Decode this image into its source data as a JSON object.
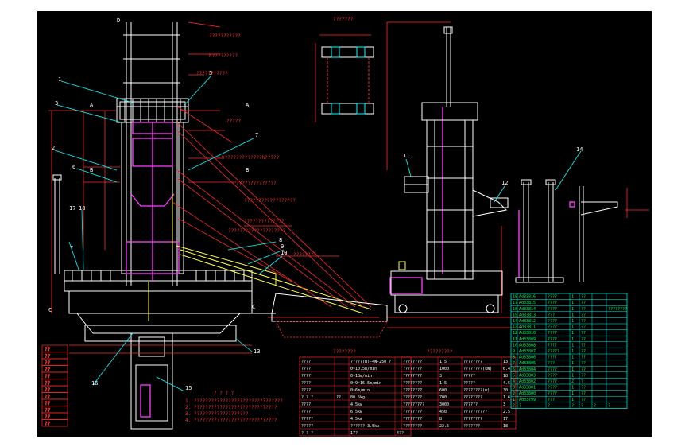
{
  "colors": {
    "background": "#000000",
    "structure": "#ffffff",
    "dimension": "#ff2a2a",
    "leader": "#00ffff",
    "hydraulic": "#ff40ff",
    "tube": "#ffff40",
    "table_grid": "#ff2a2a",
    "parts_grid": "#00ffee"
  },
  "top_label": "???????",
  "top_right_label": "?????? ?",
  "callouts_left": [
    "1",
    "2",
    "3",
    "4",
    "5",
    "6",
    "7",
    "8",
    "9",
    "10",
    "13",
    "15",
    "16",
    "17",
    "18",
    "A",
    "A",
    "B",
    "B",
    "C",
    "C",
    "D"
  ],
  "callouts_right": [
    "11",
    "12",
    "14"
  ],
  "leader_texts": [
    "???????????",
    "h?????????",
    "???????????",
    "?????",
    "h?????????????h?????",
    "??????????????",
    "??????????????????",
    "??????????????",
    "????????????????????",
    "????????"
  ],
  "notes": {
    "title": "? ? ? ?",
    "lines": [
      "1. ???????????????????????????????",
      "2. ?????????????????????????????",
      "3. ???????????????????",
      "4. ?????????????????????????????"
    ]
  },
  "spec_table_left": {
    "title": "????????",
    "rows": [
      [
        "????",
        "",
        "?????(W)-4W-250 ?",
        ""
      ],
      [
        "????",
        "",
        "0~10.5m/min",
        ""
      ],
      [
        "????",
        "",
        "0~18m/min",
        ""
      ],
      [
        "????",
        "",
        "0~9~16.5m/min",
        ""
      ],
      [
        "????",
        "",
        "0~6m/min",
        ""
      ],
      [
        "? ? ?",
        "??",
        "80.5kg",
        ""
      ],
      [
        "????",
        "",
        "4.5kw",
        ""
      ],
      [
        "????",
        "",
        "6.5kw",
        ""
      ],
      [
        "?????",
        "",
        "4.5kw",
        ""
      ],
      [
        "?????",
        "",
        "?????? 3.5kw",
        ""
      ],
      [
        "? ? ?",
        "",
        "17?",
        "4??"
      ]
    ]
  },
  "spec_table_right": {
    "title": "?????????",
    "rows": [
      [
        "????????",
        "1.5",
        "????????",
        "13"
      ],
      [
        "????????",
        "1000",
        "????????(kW)",
        "6.4"
      ],
      [
        "????????",
        "3",
        "?????",
        "18"
      ],
      [
        "????????",
        "1.5",
        "?????",
        "4.5"
      ],
      [
        "????????",
        "600",
        "????????(m)",
        "30"
      ],
      [
        "????????",
        "700",
        "????????",
        "1.6"
      ],
      [
        "?????????",
        "3000",
        "??????",
        "3"
      ],
      [
        "????????",
        "450",
        "??????????",
        "2.5"
      ],
      [
        "????????",
        "8",
        "????????",
        "17"
      ],
      [
        "????????",
        "22.5",
        "???????",
        "18"
      ]
    ]
  },
  "parts_list": {
    "rows": [
      [
        "18",
        "Ad33816",
        "????",
        "1",
        "??",
        "",
        ""
      ],
      [
        "17",
        "Ad33815",
        "????",
        "1",
        "??",
        "",
        ""
      ],
      [
        "16",
        "Ad33814",
        "????",
        "1",
        "??",
        "",
        "????????"
      ],
      [
        "15",
        "Ad33813",
        "???",
        "1",
        "??",
        "",
        ""
      ],
      [
        "14",
        "Ad33812",
        "????",
        "1",
        "??",
        "",
        ""
      ],
      [
        "13",
        "Ad33811",
        "????",
        "1",
        "??",
        "",
        ""
      ],
      [
        "12",
        "Ad33810",
        "????",
        "1",
        "??",
        "",
        ""
      ],
      [
        "11",
        "Ad33809",
        "????",
        "1",
        "??",
        "",
        ""
      ],
      [
        "10",
        "Ad33808",
        "????",
        "1",
        "??",
        "",
        ""
      ],
      [
        "9",
        "Ad33807",
        "?????",
        "1",
        "??",
        "",
        ""
      ],
      [
        "8",
        "Ad33806",
        "????",
        "1",
        "??",
        "",
        ""
      ],
      [
        "7",
        "Ad33805",
        "???",
        "1",
        "??",
        "",
        ""
      ],
      [
        "6",
        "Ad33804",
        "????",
        "1",
        "??",
        "",
        ""
      ],
      [
        "5",
        "Ad33803",
        "????",
        "1",
        "??",
        "",
        ""
      ],
      [
        "4",
        "Ad33802",
        "????",
        "2",
        "?",
        "",
        ""
      ],
      [
        "3",
        "Ad33801",
        "????",
        "1",
        "??",
        "",
        ""
      ],
      [
        "2",
        "Ad33800",
        "????",
        "1",
        "??",
        "",
        ""
      ],
      [
        "1",
        "Ad33799",
        "???",
        "1",
        "??",
        "",
        ""
      ]
    ],
    "header": [
      "?",
      "?",
      "?",
      "?",
      "?",
      "?",
      "?"
    ]
  },
  "legend_box": [
    "??",
    "??",
    "??",
    "??",
    "??",
    "??",
    "??",
    "??",
    "??",
    "??",
    "??",
    "??"
  ]
}
